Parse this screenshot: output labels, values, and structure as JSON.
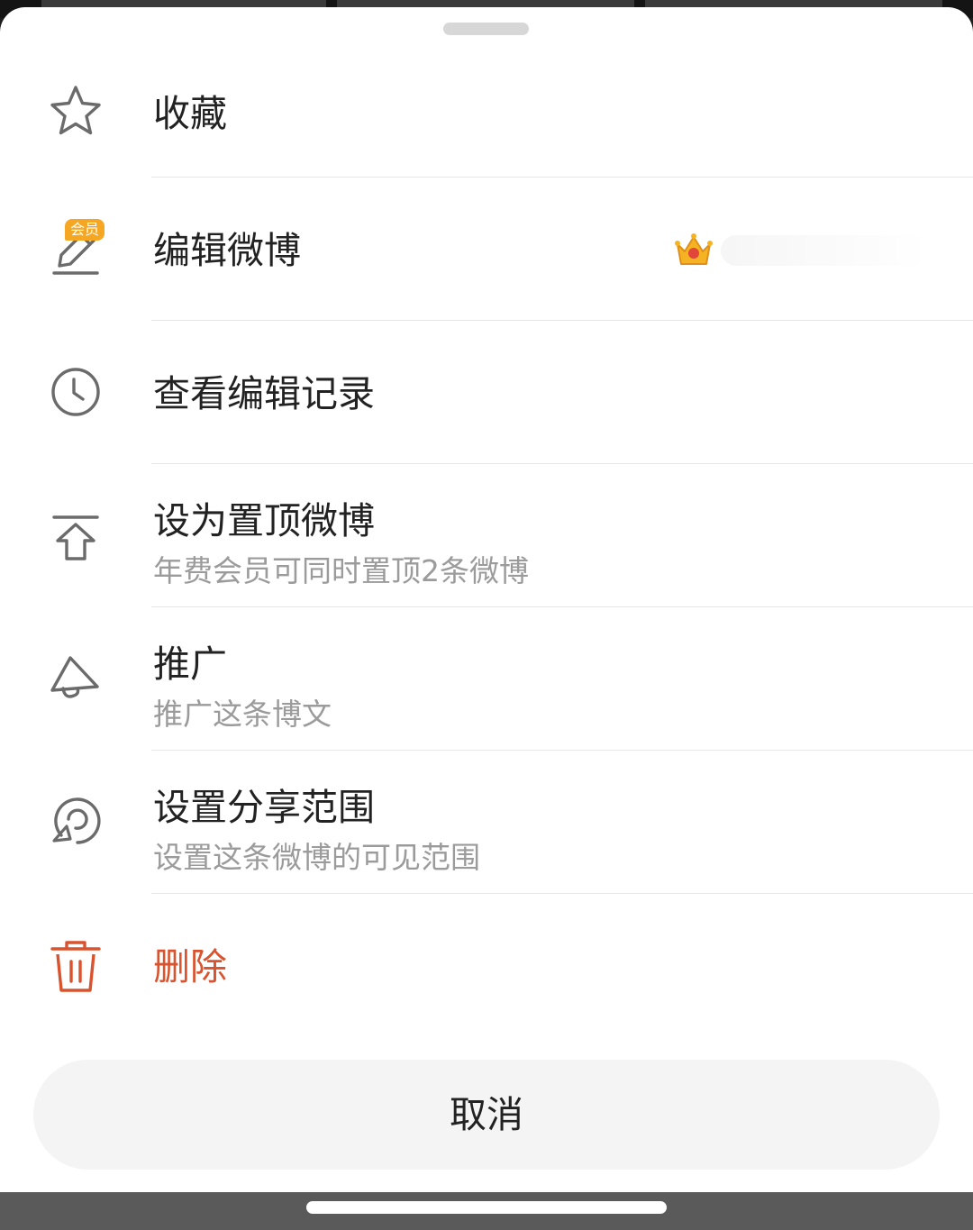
{
  "sheet": {
    "items": [
      {
        "label": "收藏",
        "icon": "star-icon"
      },
      {
        "label": "编辑微博",
        "icon": "edit-pencil-icon",
        "badge": "会员",
        "trailing_icon": "vip-crown-icon"
      },
      {
        "label": "查看编辑记录",
        "icon": "clock-icon"
      },
      {
        "label": "设为置顶微博",
        "sublabel": "年费会员可同时置顶2条微博",
        "icon": "pin-to-top-icon"
      },
      {
        "label": "推广",
        "sublabel": "推广这条博文",
        "icon": "megaphone-icon"
      },
      {
        "label": "设置分享范围",
        "sublabel": "设置这条微博的可见范围",
        "icon": "share-scope-icon"
      },
      {
        "label": "删除",
        "icon": "trash-icon",
        "color": "#d9532f"
      }
    ],
    "cancel_label": "取消"
  },
  "colors": {
    "danger": "#d9532f",
    "icon_gray": "#6b6b6b",
    "vip_badge": "#f5a623"
  }
}
